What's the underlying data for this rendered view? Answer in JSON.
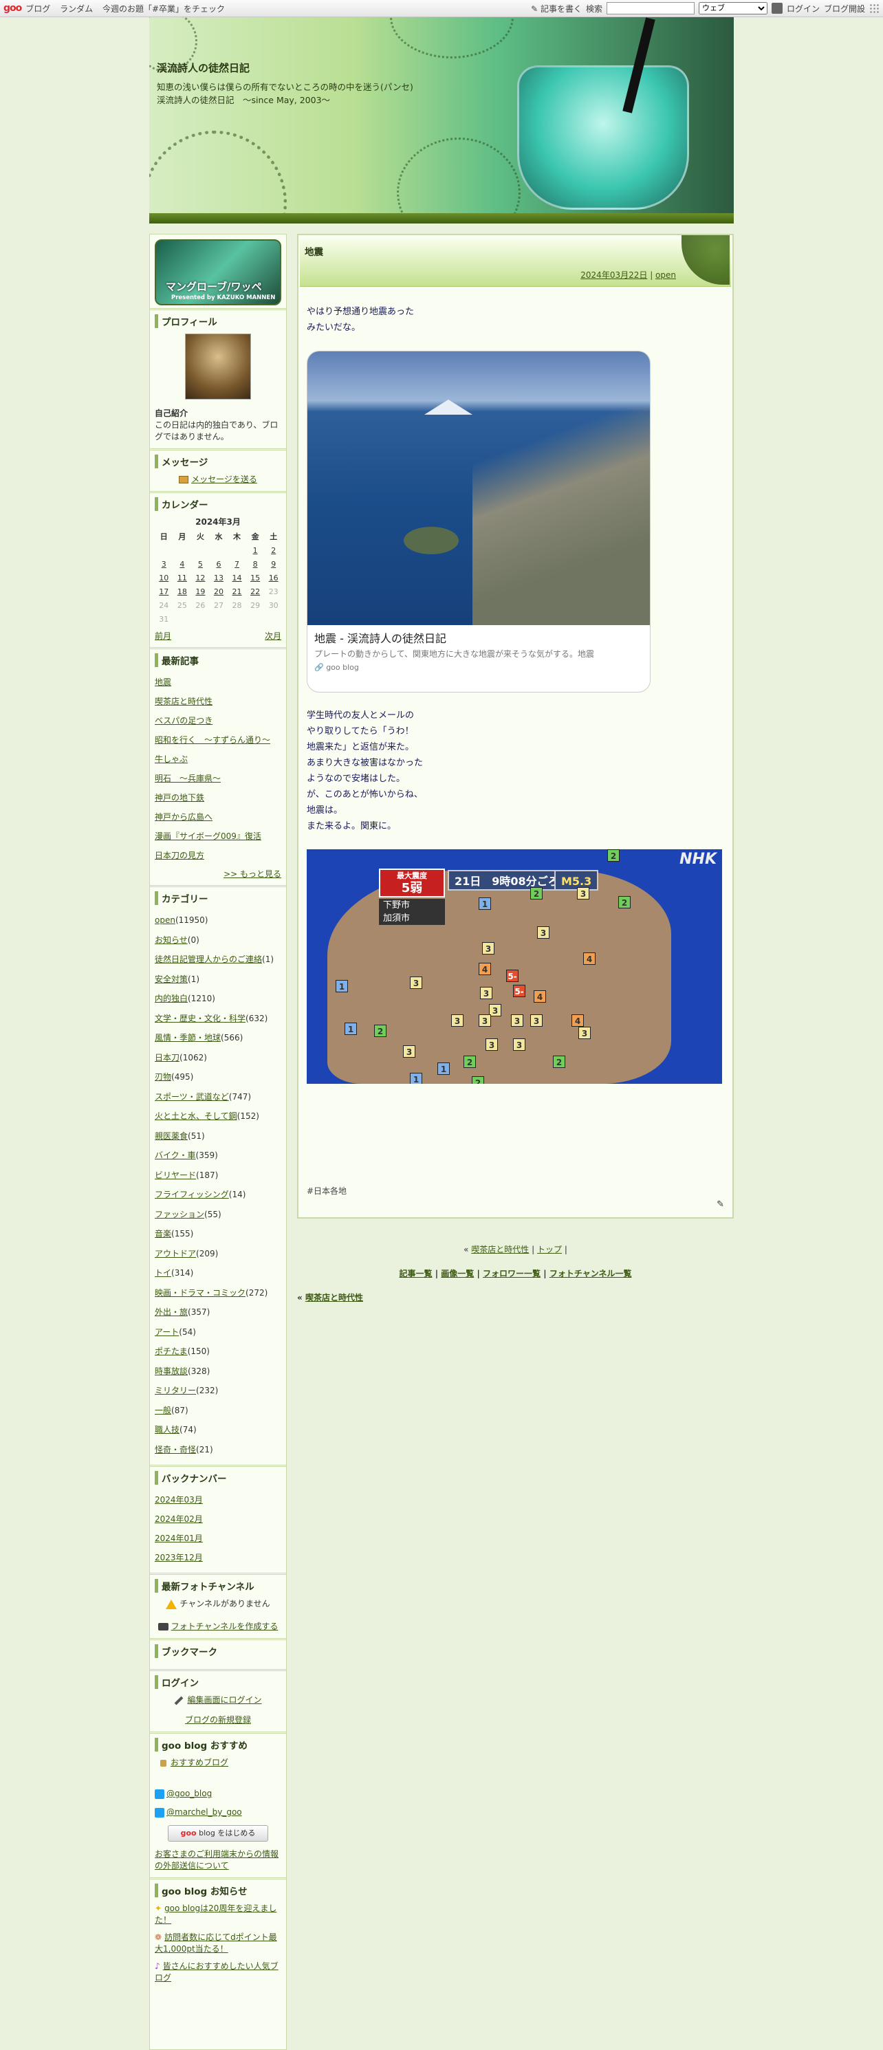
{
  "topbar": {
    "logo": "goo",
    "nav": [
      "ブログ",
      "ランダム",
      "今週のお題「#卒業」をチェック"
    ],
    "write": "記事を書く",
    "search_label": "検索",
    "search_scope": "ウェブ",
    "login": "ログイン",
    "open_blog": "ブログ開設"
  },
  "header": {
    "title": "渓流詩人の徒然日記",
    "description": "知恵の浅い僕らは僕らの所有でないところの時の中を迷う(パンセ)　渓流詩人の徒然日記　～since May, 2003～"
  },
  "sidebar": {
    "banner_title": "マングローブ/ワッペ",
    "banner_sub": "Presented by KAZUKO MANNEN",
    "profile": {
      "heading": "プロフィール",
      "intro_heading": "自己紹介",
      "intro_text": "この日記は内的独白であり、ブログではありません。"
    },
    "message": {
      "heading": "メッセージ",
      "link": "メッセージを送る"
    },
    "calendar": {
      "heading": "カレンダー",
      "month": "2024年3月",
      "weekdays": [
        "日",
        "月",
        "火",
        "水",
        "木",
        "金",
        "土"
      ],
      "rows": [
        [
          "",
          "",
          "",
          "",
          "",
          "1",
          "2"
        ],
        [
          "3",
          "4",
          "5",
          "6",
          "7",
          "8",
          "9"
        ],
        [
          "10",
          "11",
          "12",
          "13",
          "14",
          "15",
          "16"
        ],
        [
          "17",
          "18",
          "19",
          "20",
          "21",
          "22",
          "23"
        ],
        [
          "24",
          "25",
          "26",
          "27",
          "28",
          "29",
          "30"
        ],
        [
          "31",
          "",
          "",
          "",
          "",
          "",
          ""
        ]
      ],
      "prev": "前月",
      "next": "次月"
    },
    "recent": {
      "heading": "最新記事",
      "items": [
        "地震",
        "喫茶店と時代性",
        "ベスパの足つき",
        "昭和を行く　～すずらん通り～",
        "牛しゃぶ",
        "明石　～兵庫県～",
        "神戸の地下鉄",
        "神戸から広島へ",
        "漫画『サイボーグ009』復活",
        "日本刀の見方"
      ],
      "more": ">> もっと見る"
    },
    "categories": {
      "heading": "カテゴリー",
      "items": [
        {
          "name": "open",
          "count": "(11950)"
        },
        {
          "name": "お知らせ",
          "count": "(0)"
        },
        {
          "name": "徒然日記管理人からのご連絡",
          "count": "(1)"
        },
        {
          "name": "安全対策",
          "count": "(1)"
        },
        {
          "name": "内的独白",
          "count": "(1210)"
        },
        {
          "name": "文学・歴史・文化・科学",
          "count": "(632)"
        },
        {
          "name": "風情・季節・地球",
          "count": "(566)"
        },
        {
          "name": "日本刀",
          "count": "(1062)"
        },
        {
          "name": "刃物",
          "count": "(495)"
        },
        {
          "name": "スポーツ・武道など",
          "count": "(747)"
        },
        {
          "name": "火と土と水、そして鋼",
          "count": "(152)"
        },
        {
          "name": "親医薬食",
          "count": "(51)"
        },
        {
          "name": "バイク・車",
          "count": "(359)"
        },
        {
          "name": "ビリヤード",
          "count": "(187)"
        },
        {
          "name": "フライフィッシング",
          "count": "(14)"
        },
        {
          "name": "ファッション",
          "count": "(55)"
        },
        {
          "name": "音楽",
          "count": "(155)"
        },
        {
          "name": "アウトドア",
          "count": "(209)"
        },
        {
          "name": "トイ",
          "count": "(314)"
        },
        {
          "name": "映画・ドラマ・コミック",
          "count": "(272)"
        },
        {
          "name": "外出・旅",
          "count": "(357)"
        },
        {
          "name": "アート",
          "count": "(54)"
        },
        {
          "name": "ポチたま",
          "count": "(150)"
        },
        {
          "name": "時事放談",
          "count": "(328)"
        },
        {
          "name": "ミリタリー",
          "count": "(232)"
        },
        {
          "name": "一般",
          "count": "(87)"
        },
        {
          "name": "職人技",
          "count": "(74)"
        },
        {
          "name": "怪奇・奇怪",
          "count": "(21)"
        }
      ]
    },
    "backnumber": {
      "heading": "バックナンバー",
      "items": [
        "2024年03月",
        "2024年02月",
        "2024年01月",
        "2023年12月"
      ]
    },
    "photochannel": {
      "heading": "最新フォトチャンネル",
      "none": "チャンネルがありません",
      "create": "フォトチャンネルを作成する"
    },
    "bookmark": {
      "heading": "ブックマーク"
    },
    "login": {
      "heading": "ログイン",
      "edit": "編集画面にログイン",
      "register": "ブログの新規登録"
    },
    "recommend": {
      "heading": "goo blog おすすめ",
      "link": "おすすめブログ",
      "tw1": "@goo_blog",
      "tw2": "@marchel_by_goo",
      "start_logo": "goo",
      "start_text": "blog をはじめる",
      "notice": "お客さまのご利用端末からの情報の外部送信について"
    },
    "news": {
      "heading": "goo blog お知らせ",
      "items": [
        "goo blogは20周年を迎えました！",
        "訪問者数に応じてdポイント最大1,000pt当たる！",
        "皆さんにおすすめしたい人気ブログ"
      ]
    }
  },
  "entry": {
    "title": "地震",
    "date": "2024年03月22日",
    "category": "open",
    "intro": [
      "やはり予想通り地震あった",
      "みたいだな。"
    ],
    "card": {
      "title": "地震 - 渓流詩人の徒然日記",
      "desc": "プレートの動きからして、関東地方に大きな地震が来そうな気がする。地震",
      "source": "goo blog"
    },
    "body": [
      "学生時代の友人とメールの",
      "やり取りしてたら「うわ！",
      "地震来た」と返信が来た。",
      "あまり大きな被害はなかった",
      "ようなので安堵はした。",
      "が、このあとが怖いからね、",
      "地震は。",
      "また来るよ。関東に。"
    ],
    "map": {
      "logo": "NHK",
      "max_label": "最大震度",
      "max_value": "5弱",
      "time": "21日　9時08分ごろ",
      "magnitude": "M5.3",
      "cities": [
        "下野市",
        "加須市"
      ]
    },
    "tag": "#日本各地"
  },
  "footer": {
    "prev": "喫茶店と時代性",
    "top": "トップ",
    "links": [
      "記事一覧",
      "画像一覧",
      "フォロワー一覧",
      "フォトチャンネル一覧"
    ],
    "back": "喫茶店と時代性"
  }
}
